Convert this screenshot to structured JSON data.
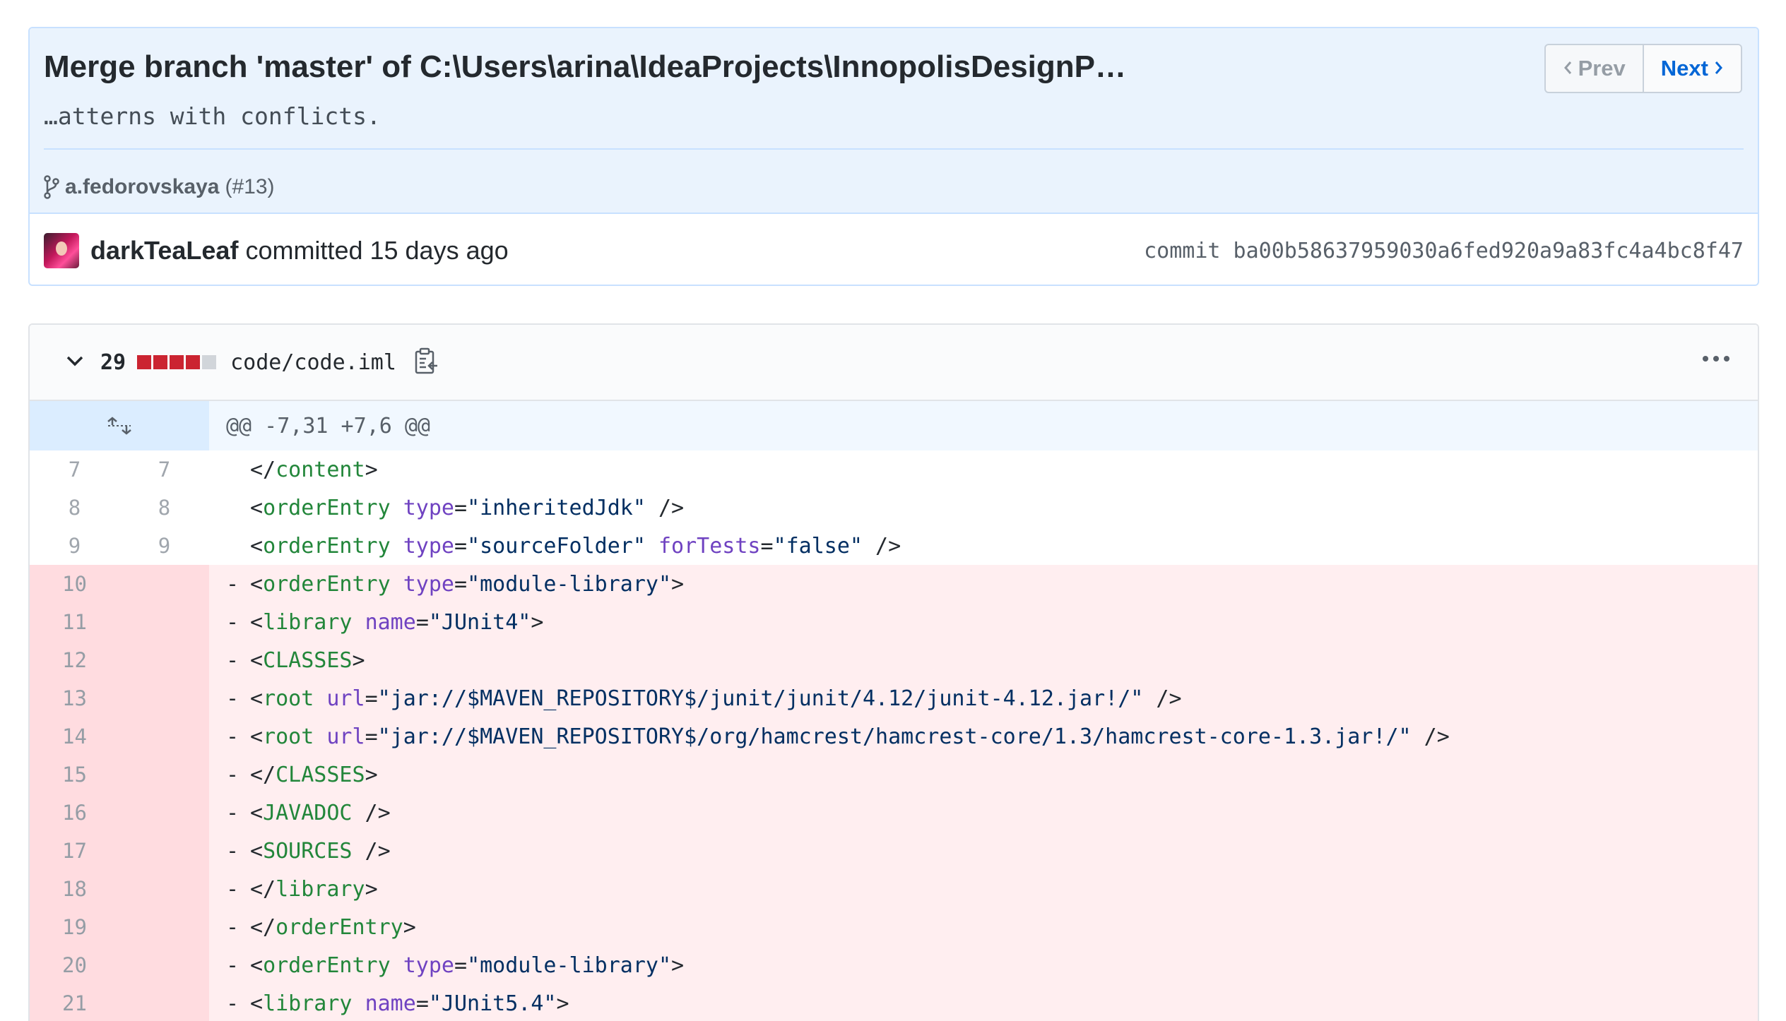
{
  "commit": {
    "title": "Merge branch 'master' of C:\\Users\\arina\\IdeaProjects\\InnopolisDesignP…",
    "description": "…atterns with conflicts.",
    "branch": "a.fedorovskaya",
    "pr": "(#13)",
    "author": "darkTeaLeaf",
    "committed_text": "committed 15 days ago",
    "sha_text": "commit ba00b58637959030a6fed920a9a83fc4a4bc8f47"
  },
  "pager": {
    "prev": "Prev",
    "next": "Next"
  },
  "file": {
    "changes": "29",
    "path": "code/code.iml",
    "diffstat": [
      "del",
      "del",
      "del",
      "del",
      "neutral"
    ],
    "hunk": "@@ -7,31 +7,6 @@"
  },
  "lines": [
    {
      "type": "ctx",
      "old": "7",
      "new": "7",
      "indent": "      ",
      "tokens": [
        [
          "p",
          "</"
        ],
        [
          "t",
          "content"
        ],
        [
          "p",
          ">"
        ]
      ]
    },
    {
      "type": "ctx",
      "old": "8",
      "new": "8",
      "indent": "      ",
      "tokens": [
        [
          "p",
          "<"
        ],
        [
          "t",
          "orderEntry"
        ],
        [
          "p",
          " "
        ],
        [
          "a",
          "type"
        ],
        [
          "p",
          "="
        ],
        [
          "s",
          "\"inheritedJdk\""
        ],
        [
          "p",
          " />"
        ]
      ]
    },
    {
      "type": "ctx",
      "old": "9",
      "new": "9",
      "indent": "      ",
      "tokens": [
        [
          "p",
          "<"
        ],
        [
          "t",
          "orderEntry"
        ],
        [
          "p",
          " "
        ],
        [
          "a",
          "type"
        ],
        [
          "p",
          "="
        ],
        [
          "s",
          "\"sourceFolder\""
        ],
        [
          "p",
          " "
        ],
        [
          "a",
          "forTests"
        ],
        [
          "p",
          "="
        ],
        [
          "s",
          "\"false\""
        ],
        [
          "p",
          " />"
        ]
      ]
    },
    {
      "type": "del",
      "old": "10",
      "new": "",
      "indent": "    ",
      "tokens": [
        [
          "p",
          "<"
        ],
        [
          "t",
          "orderEntry"
        ],
        [
          "p",
          " "
        ],
        [
          "a",
          "type"
        ],
        [
          "p",
          "="
        ],
        [
          "s",
          "\"module-library\""
        ],
        [
          "p",
          ">"
        ]
      ]
    },
    {
      "type": "del",
      "old": "11",
      "new": "",
      "indent": "      ",
      "tokens": [
        [
          "p",
          "<"
        ],
        [
          "t",
          "library"
        ],
        [
          "p",
          " "
        ],
        [
          "a",
          "name"
        ],
        [
          "p",
          "="
        ],
        [
          "s",
          "\"JUnit4\""
        ],
        [
          "p",
          ">"
        ]
      ]
    },
    {
      "type": "del",
      "old": "12",
      "new": "",
      "indent": "        ",
      "tokens": [
        [
          "p",
          "<"
        ],
        [
          "t",
          "CLASSES"
        ],
        [
          "p",
          ">"
        ]
      ]
    },
    {
      "type": "del",
      "old": "13",
      "new": "",
      "indent": "          ",
      "tokens": [
        [
          "p",
          "<"
        ],
        [
          "t",
          "root"
        ],
        [
          "p",
          " "
        ],
        [
          "a",
          "url"
        ],
        [
          "p",
          "="
        ],
        [
          "s",
          "\"jar://$MAVEN_REPOSITORY$/junit/junit/4.12/junit-4.12.jar!/\""
        ],
        [
          "p",
          " />"
        ]
      ]
    },
    {
      "type": "del",
      "old": "14",
      "new": "",
      "indent": "          ",
      "tokens": [
        [
          "p",
          "<"
        ],
        [
          "t",
          "root"
        ],
        [
          "p",
          " "
        ],
        [
          "a",
          "url"
        ],
        [
          "p",
          "="
        ],
        [
          "s",
          "\"jar://$MAVEN_REPOSITORY$/org/hamcrest/hamcrest-core/1.3/hamcrest-core-1.3.jar!/\""
        ],
        [
          "p",
          " />"
        ]
      ]
    },
    {
      "type": "del",
      "old": "15",
      "new": "",
      "indent": "        ",
      "tokens": [
        [
          "p",
          "</"
        ],
        [
          "t",
          "CLASSES"
        ],
        [
          "p",
          ">"
        ]
      ]
    },
    {
      "type": "del",
      "old": "16",
      "new": "",
      "indent": "        ",
      "tokens": [
        [
          "p",
          "<"
        ],
        [
          "t",
          "JAVADOC"
        ],
        [
          "p",
          " />"
        ]
      ]
    },
    {
      "type": "del",
      "old": "17",
      "new": "",
      "indent": "        ",
      "tokens": [
        [
          "p",
          "<"
        ],
        [
          "t",
          "SOURCES"
        ],
        [
          "p",
          " />"
        ]
      ]
    },
    {
      "type": "del",
      "old": "18",
      "new": "",
      "indent": "      ",
      "tokens": [
        [
          "p",
          "</"
        ],
        [
          "t",
          "library"
        ],
        [
          "p",
          ">"
        ]
      ]
    },
    {
      "type": "del",
      "old": "19",
      "new": "",
      "indent": "    ",
      "tokens": [
        [
          "p",
          "</"
        ],
        [
          "t",
          "orderEntry"
        ],
        [
          "p",
          ">"
        ]
      ]
    },
    {
      "type": "del",
      "old": "20",
      "new": "",
      "indent": "    ",
      "tokens": [
        [
          "p",
          "<"
        ],
        [
          "t",
          "orderEntry"
        ],
        [
          "p",
          " "
        ],
        [
          "a",
          "type"
        ],
        [
          "p",
          "="
        ],
        [
          "s",
          "\"module-library\""
        ],
        [
          "p",
          ">"
        ]
      ]
    },
    {
      "type": "del",
      "old": "21",
      "new": "",
      "indent": "      ",
      "tokens": [
        [
          "p",
          "<"
        ],
        [
          "t",
          "library"
        ],
        [
          "p",
          " "
        ],
        [
          "a",
          "name"
        ],
        [
          "p",
          "="
        ],
        [
          "s",
          "\"JUnit5.4\""
        ],
        [
          "p",
          ">"
        ]
      ]
    }
  ],
  "colors": {
    "header_bg": "#eaf3fd",
    "link": "#0366d6",
    "deletion_bg": "#ffeef0",
    "deletion_gutter": "#ffdce0",
    "deletion_stat": "#cb2431",
    "xml_tag": "#22863a",
    "xml_attr": "#6f42c1",
    "xml_string": "#032f62"
  }
}
